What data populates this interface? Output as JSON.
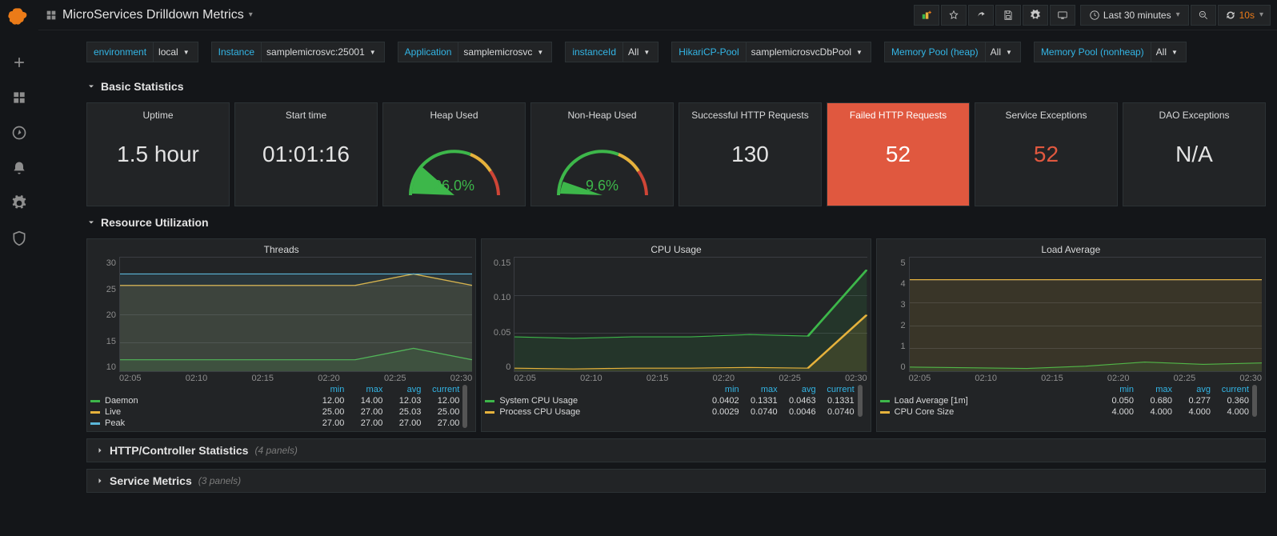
{
  "header": {
    "title": "MicroServices Drilldown Metrics",
    "time_range": "Last 30 minutes",
    "refresh_interval": "10s"
  },
  "filters": [
    {
      "label": "environment",
      "value": "local"
    },
    {
      "label": "Instance",
      "value": "samplemicrosvc:25001"
    },
    {
      "label": "Application",
      "value": "samplemicrosvc"
    },
    {
      "label": "instanceId",
      "value": "All"
    },
    {
      "label": "HikariCP-Pool",
      "value": "samplemicrosvcDbPool"
    },
    {
      "label": "Memory Pool (heap)",
      "value": "All"
    },
    {
      "label": "Memory Pool (nonheap)",
      "value": "All"
    }
  ],
  "sections": {
    "basic": {
      "title": "Basic Statistics"
    },
    "resource": {
      "title": "Resource Utilization"
    },
    "http": {
      "title": "HTTP/Controller Statistics",
      "meta": "(4 panels)"
    },
    "service": {
      "title": "Service Metrics",
      "meta": "(3 panels)"
    }
  },
  "stats": {
    "uptime": {
      "title": "Uptime",
      "value": "1.5 hour"
    },
    "start": {
      "title": "Start time",
      "value": "01:01:16"
    },
    "heap": {
      "title": "Heap Used",
      "value": "26.0%"
    },
    "nonheap": {
      "title": "Non-Heap Used",
      "value": "9.6%"
    },
    "success": {
      "title": "Successful HTTP Requests",
      "value": "130"
    },
    "failed": {
      "title": "Failed HTTP Requests",
      "value": "52"
    },
    "service_exc": {
      "title": "Service Exceptions",
      "value": "52"
    },
    "dao_exc": {
      "title": "DAO Exceptions",
      "value": "N/A"
    }
  },
  "legend_headers": [
    "min",
    "max",
    "avg",
    "current"
  ],
  "charts": {
    "threads": {
      "title": "Threads",
      "x_ticks": [
        "02:05",
        "02:10",
        "02:15",
        "02:20",
        "02:25",
        "02:30"
      ],
      "y_ticks": [
        "30",
        "25",
        "20",
        "15",
        "10"
      ],
      "series": [
        {
          "name": "Daemon",
          "color": "#3db74a",
          "min": "12.00",
          "max": "14.00",
          "avg": "12.03",
          "current": "12.00"
        },
        {
          "name": "Live",
          "color": "#e6b23c",
          "min": "25.00",
          "max": "27.00",
          "avg": "25.03",
          "current": "25.00"
        },
        {
          "name": "Peak",
          "color": "#5bb7d9",
          "min": "27.00",
          "max": "27.00",
          "avg": "27.00",
          "current": "27.00"
        }
      ]
    },
    "cpu": {
      "title": "CPU Usage",
      "x_ticks": [
        "02:05",
        "02:10",
        "02:15",
        "02:20",
        "02:25",
        "02:30"
      ],
      "y_ticks": [
        "0.15",
        "0.10",
        "0.05",
        "0"
      ],
      "series": [
        {
          "name": "System CPU Usage",
          "color": "#3db74a",
          "min": "0.0402",
          "max": "0.1331",
          "avg": "0.0463",
          "current": "0.1331"
        },
        {
          "name": "Process CPU Usage",
          "color": "#e6b23c",
          "min": "0.0029",
          "max": "0.0740",
          "avg": "0.0046",
          "current": "0.0740"
        }
      ]
    },
    "load": {
      "title": "Load Average",
      "x_ticks": [
        "02:05",
        "02:10",
        "02:15",
        "02:20",
        "02:25",
        "02:30"
      ],
      "y_ticks": [
        "5",
        "4",
        "3",
        "2",
        "1",
        "0"
      ],
      "series": [
        {
          "name": "Load Average [1m]",
          "color": "#3db74a",
          "min": "0.050",
          "max": "0.680",
          "avg": "0.277",
          "current": "0.360"
        },
        {
          "name": "CPU Core Size",
          "color": "#e6b23c",
          "min": "4.000",
          "max": "4.000",
          "avg": "4.000",
          "current": "4.000"
        }
      ]
    }
  },
  "chart_data": [
    {
      "type": "line",
      "title": "Threads",
      "xlabel": "",
      "ylabel": "",
      "x": [
        "02:05",
        "02:10",
        "02:15",
        "02:20",
        "02:25",
        "02:30"
      ],
      "ylim": [
        10,
        30
      ],
      "series": [
        {
          "name": "Daemon",
          "values": [
            12,
            12,
            12,
            12,
            12,
            14,
            12
          ]
        },
        {
          "name": "Live",
          "values": [
            25,
            25,
            25,
            25,
            25,
            27,
            25
          ]
        },
        {
          "name": "Peak",
          "values": [
            27,
            27,
            27,
            27,
            27,
            27,
            27
          ]
        }
      ]
    },
    {
      "type": "line",
      "title": "CPU Usage",
      "xlabel": "",
      "ylabel": "",
      "x": [
        "02:05",
        "02:10",
        "02:15",
        "02:20",
        "02:25",
        "02:30"
      ],
      "ylim": [
        0,
        0.15
      ],
      "series": [
        {
          "name": "System CPU Usage",
          "values": [
            0.045,
            0.043,
            0.045,
            0.045,
            0.048,
            0.046,
            0.133
          ]
        },
        {
          "name": "Process CPU Usage",
          "values": [
            0.004,
            0.003,
            0.004,
            0.004,
            0.005,
            0.004,
            0.074
          ]
        }
      ]
    },
    {
      "type": "line",
      "title": "Load Average",
      "xlabel": "",
      "ylabel": "",
      "x": [
        "02:05",
        "02:10",
        "02:15",
        "02:20",
        "02:25",
        "02:30"
      ],
      "ylim": [
        0,
        5
      ],
      "series": [
        {
          "name": "Load Average [1m]",
          "values": [
            0.18,
            0.15,
            0.12,
            0.22,
            0.4,
            0.3,
            0.36
          ]
        },
        {
          "name": "CPU Core Size",
          "values": [
            4,
            4,
            4,
            4,
            4,
            4,
            4
          ]
        }
      ]
    }
  ]
}
